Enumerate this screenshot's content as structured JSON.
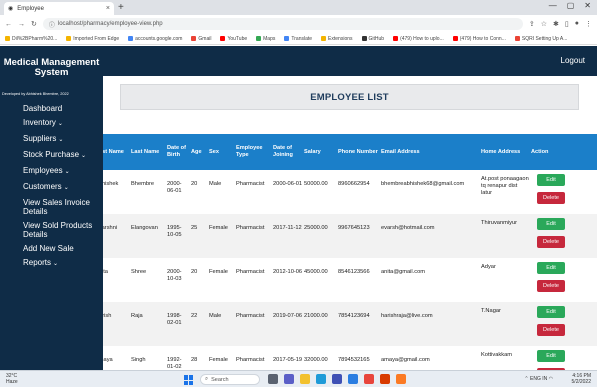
{
  "browser": {
    "tab_title": "Employee",
    "url": "localhost/pharmacy/employee-view.php",
    "bookmarks": [
      {
        "label": "Dil%2BPharm%20...",
        "color": "#f4b400"
      },
      {
        "label": "Imported From Edge",
        "color": "#f4b400"
      },
      {
        "label": "accounts.google.com",
        "color": "#4285f4"
      },
      {
        "label": "Gmail",
        "color": "#ea4335"
      },
      {
        "label": "YouTube",
        "color": "#ff0000"
      },
      {
        "label": "Maps",
        "color": "#34a853"
      },
      {
        "label": "Translate",
        "color": "#4285f4"
      },
      {
        "label": "Extensions",
        "color": "#f4b400"
      },
      {
        "label": "GitHub",
        "color": "#333333"
      },
      {
        "label": "(479) How to uplo...",
        "color": "#ff0000"
      },
      {
        "label": "(479) How to Conn...",
        "color": "#ff0000"
      },
      {
        "label": "SQRI Setting Up A...",
        "color": "#ea4335"
      }
    ]
  },
  "app": {
    "brand_title": "Medical Management System",
    "brand_subtitle": "Developed by Abhishek Bhembre, 2022",
    "logout_label": "Logout",
    "page_title": "EMPLOYEE LIST"
  },
  "sidebar": {
    "items": [
      {
        "label": "Dashboard",
        "dropdown": false
      },
      {
        "label": "Inventory",
        "dropdown": true
      },
      {
        "label": "Suppliers",
        "dropdown": true
      },
      {
        "label": "Stock Purchase",
        "dropdown": true
      },
      {
        "label": "Employees",
        "dropdown": true
      },
      {
        "label": "Customers",
        "dropdown": true
      },
      {
        "label": "View Sales Invoice Details",
        "dropdown": false
      },
      {
        "label": "View Sold Products Details",
        "dropdown": false
      },
      {
        "label": "Add New Sale",
        "dropdown": false
      },
      {
        "label": "Reports",
        "dropdown": true
      }
    ]
  },
  "table": {
    "headers": [
      "First Name",
      "Last Name",
      "Date of Birth",
      "Age",
      "Sex",
      "Employee Type",
      "Date of Joining",
      "Salary",
      "Phone Number",
      "Email Address",
      "Home Address",
      "Action"
    ],
    "rows": [
      {
        "first": "Abhishek",
        "last": "Bhembre",
        "dob": "2000-06-01",
        "age": "20",
        "sex": "Male",
        "type": "Pharmacist",
        "doj": "2000-06-01",
        "salary": "50000.00",
        "phone": "8960662954",
        "email": "bhembreabhishek68@gmail.com",
        "address": "At.post ponaagaon tq renapur dist latur"
      },
      {
        "first": "Evarshni",
        "last": "Elangovan",
        "dob": "1995-10-05",
        "age": "25",
        "sex": "Female",
        "type": "Pharmacist",
        "doj": "2017-11-12",
        "salary": "25000.00",
        "phone": "9967645123",
        "email": "evarsh@hotmail.com",
        "address": "Thiruvanmiyur"
      },
      {
        "first": "Anita",
        "last": "Shree",
        "dob": "2000-10-03",
        "age": "20",
        "sex": "Female",
        "type": "Pharmacist",
        "doj": "2012-10-06",
        "salary": "45000.00",
        "phone": "8546123566",
        "email": "anita@gmail.com",
        "address": "Adyar"
      },
      {
        "first": "Harish",
        "last": "Raja",
        "dob": "1998-02-01",
        "age": "22",
        "sex": "Male",
        "type": "Pharmacist",
        "doj": "2019-07-06",
        "salary": "21000.00",
        "phone": "7854123694",
        "email": "harishraja@live.com",
        "address": "T.Nagar"
      },
      {
        "first": "Amaya",
        "last": "Singh",
        "dob": "1992-01-02",
        "age": "28",
        "sex": "Female",
        "type": "Pharmacist",
        "doj": "2017-05-19",
        "salary": "32000.00",
        "phone": "7894532165",
        "email": "amaya@gmail.com",
        "address": "Kottivakkam"
      }
    ],
    "edit_label": "Edit",
    "delete_label": "Delete"
  },
  "taskbar": {
    "weather_temp": "32°C",
    "weather_desc": "Haze",
    "search_label": "Search",
    "time": "4:16 PM",
    "date": "5/2/2022",
    "lang": "ENG IN"
  },
  "colors": {
    "nav_bg": "#0f2c47",
    "table_header": "#1b7fc9",
    "edit": "#2aa85a",
    "delete": "#c6283c"
  }
}
